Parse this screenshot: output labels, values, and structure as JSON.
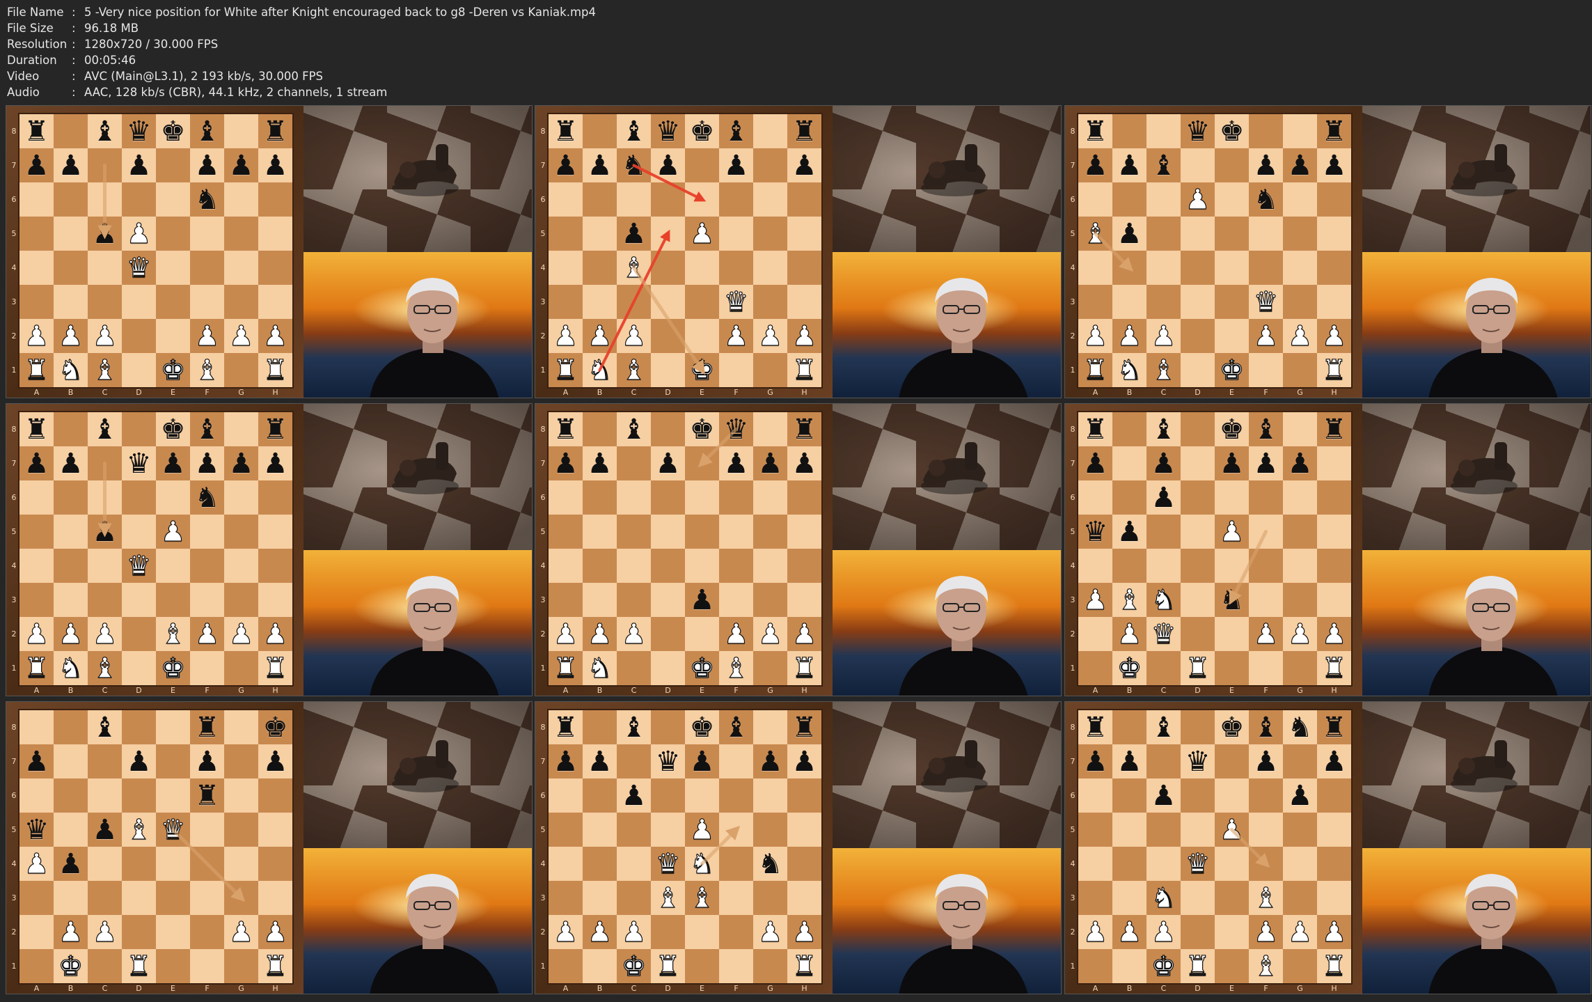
{
  "meta": {
    "rows": [
      {
        "label": "File Name",
        "value": "5 -Very nice position for White after Knight encouraged back to g8 -Deren vs Kaniak.mp4"
      },
      {
        "label": "File Size",
        "value": "96.18 MB"
      },
      {
        "label": "Resolution",
        "value": "1280x720 / 30.000 FPS"
      },
      {
        "label": "Duration",
        "value": "00:05:46"
      },
      {
        "label": "Video",
        "value": "AVC (Main@L3.1), 2 193 kb/s, 30.000 FPS"
      },
      {
        "label": "Audio",
        "value": "AAC, 128 kb/s (CBR), 44.1 kHz, 2 channels, 1 stream"
      }
    ]
  },
  "board_labels": {
    "ranks": [
      "8",
      "7",
      "6",
      "5",
      "4",
      "3",
      "2",
      "1"
    ],
    "files": [
      "A",
      "B",
      "C",
      "D",
      "E",
      "F",
      "G",
      "H"
    ]
  },
  "colors": {
    "light_square": "#f6cfa2",
    "dark_square": "#c8894f",
    "arrow_red": "#e8402a",
    "arrow_tan": "#d9a26a"
  },
  "frames": [
    {
      "fen": "r1bqkb1r/pp1p1ppp/5n2/2pP4/3Q4/8/PPP2PPP/RNB1KB1R",
      "arrows": [
        {
          "from": "c7",
          "to": "c5",
          "color": "tan"
        }
      ]
    },
    {
      "fen": "r1bqkb1r/ppnp1p1p/8/2p1P3/2B5/5Q2/PPP2PPP/RNB1K2R",
      "arrows": [
        {
          "from": "c7",
          "to": "e6",
          "color": "red"
        },
        {
          "from": "b1",
          "to": "d5",
          "color": "red"
        },
        {
          "from": "c4",
          "to": "e1",
          "color": "tan"
        }
      ]
    },
    {
      "fen": "r2qk2r/ppb2ppp/3P1n2/Bp6/8/5Q2/PPP2PPP/RNB1K2R",
      "arrows": [
        {
          "from": "a5",
          "to": "b4",
          "color": "tan"
        }
      ]
    },
    {
      "fen": "r1b1kb1r/pp1qpppp/5n2/2p1P3/3Q4/8/PPP1BPPP/RNB1K2R",
      "arrows": [
        {
          "from": "c7",
          "to": "c5",
          "color": "tan"
        }
      ]
    },
    {
      "fen": "r1b1kq1r/pp1p1ppp/8/8/8/4p3/PPP2PPP/RN2KB1R",
      "arrows": [
        {
          "from": "f8",
          "to": "e7",
          "color": "tan"
        }
      ]
    },
    {
      "fen": "r1b1kb1r/p1p1ppp1/2p5/qp2P3/8/PBN1n3/1PQ2PPP/1K1R3R",
      "arrows": [
        {
          "from": "f5",
          "to": "e3",
          "color": "tan"
        }
      ]
    },
    {
      "fen": "2b2r1k/p2p1p1p/5r2/q1pBQ3/Pp6/8/1PP3PP/1K1R3R",
      "arrows": [
        {
          "from": "e5",
          "to": "g3",
          "color": "tan"
        }
      ]
    },
    {
      "fen": "r1b1kb1r/pp1qp1pp/2p5/4P3/3QN1n1/3BB3/PPP3PP/2KR3R",
      "arrows": [
        {
          "from": "e4",
          "to": "f5",
          "color": "tan"
        }
      ]
    },
    {
      "fen": "r1b1kbnr/pp1q1p1p/2p3p1/4P3/3Q4/2N2B2/PPP2PPP/2KR1B1R",
      "arrows": [
        {
          "from": "e5",
          "to": "f4",
          "color": "tan"
        }
      ]
    }
  ]
}
